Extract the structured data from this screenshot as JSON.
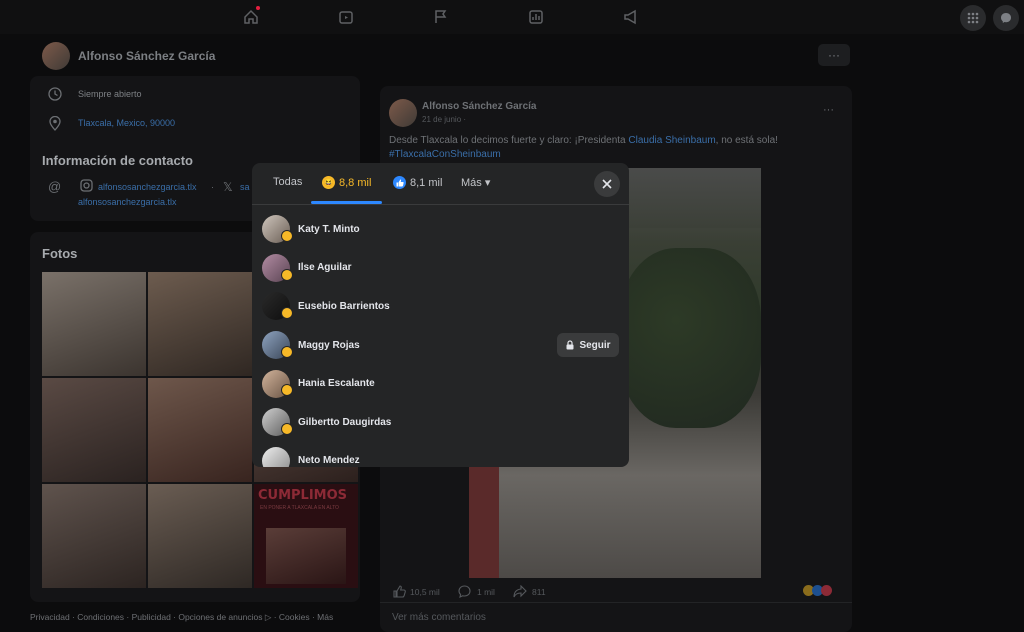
{
  "topbar": {
    "nav_icons": [
      "home-icon",
      "video-icon",
      "flag-icon",
      "chart-icon",
      "megaphone-icon"
    ],
    "right_icons": [
      "menu-grid-icon",
      "messenger-icon"
    ]
  },
  "profile": {
    "name": "Alfonso Sánchez García",
    "more": "···"
  },
  "intro": {
    "hours": "Siempre abierto",
    "address": "Tlaxcala, Mexico, 90000",
    "contact_title": "Información de contacto",
    "instagram": "alfonsosanchezgarcia.tlx",
    "separator": "·",
    "x_handle_partial": "sa",
    "second_line": "alfonsosanchezgarcia.tlx"
  },
  "photos": {
    "title": "Fotos",
    "poster_text": "CUMPLIMOS",
    "poster_sub": "EN PONER A TLAXCALA EN ALTO"
  },
  "post": {
    "author": "Alfonso Sánchez García",
    "date": "21 de junio ·",
    "more": "···",
    "text_before": "Desde Tlaxcala lo decimos fuerte y claro: ¡Presidenta ",
    "mention": "Claudia Sheinbaum",
    "text_after": ", no está sola!",
    "hashtag": "#TlaxcalaConSheinbaum",
    "likes": "10,5 mil",
    "comments": "1 mil",
    "shares": "811",
    "more_comments": "Ver más comentarios"
  },
  "modal": {
    "tabs": [
      {
        "label": "Todas"
      },
      {
        "label": "8,8 mil",
        "icon": "haha-emoji-icon",
        "color": "#f7b928"
      },
      {
        "label": "8,1 mil",
        "icon": "like-icon",
        "color": "#2d88ff"
      },
      {
        "label": "Más ▾"
      }
    ],
    "people": [
      {
        "name": "Katy T. Minto"
      },
      {
        "name": "Ilse Aguilar"
      },
      {
        "name": "Eusebio Barrientos"
      },
      {
        "name": "Maggy Rojas",
        "follow_label": "Seguir"
      },
      {
        "name": "Hania Escalante"
      },
      {
        "name": "Gilbertto Daugirdas"
      },
      {
        "name": "Neto Mendez"
      }
    ]
  },
  "footer": "Privacidad · Condiciones · Publicidad · Opciones de anuncios ▷ · Cookies · Más"
}
